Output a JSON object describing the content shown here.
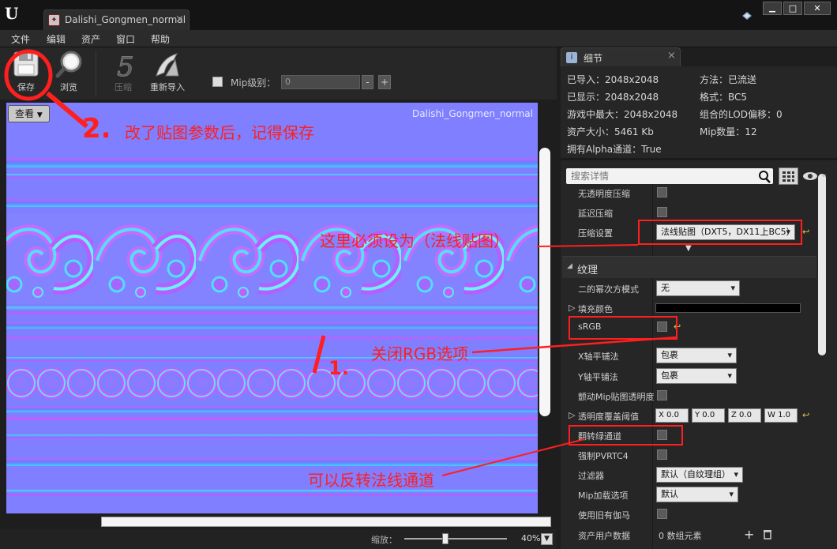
{
  "app": {
    "logo": "unreal-logo-icon",
    "tab_title": "Dalishi_Gongmen_normal",
    "tab_close": "×",
    "window_min": "▁",
    "window_max": "□",
    "window_close": "✕"
  },
  "menu": [
    "文件",
    "编辑",
    "资产",
    "窗口",
    "帮助"
  ],
  "toolbar": {
    "save": "保存",
    "browse": "浏览",
    "compress": "压缩",
    "reimport": "重新导入",
    "mip_label": "Mip级别：",
    "mip_value": "0",
    "mip_minus": "-",
    "mip_plus": "+"
  },
  "viewport": {
    "view_button": "查看",
    "texture_name": "Dalishi_Gongmen_normal",
    "zoom_label": "缩放：",
    "zoom_value": "40%",
    "zoom_fraction": 0.4
  },
  "details": {
    "tab_label": "细节",
    "tab_close": "×",
    "info_left": [
      "已导入：2048x2048",
      "已显示：2048x2048",
      "游戏中最大：2048x2048",
      "资产大小：5461 Kb",
      "拥有Alpha通道：True"
    ],
    "info_right": [
      "方法：已流送",
      "格式：BC5",
      "组合的LOD偏移：0",
      "Mip数量：12"
    ],
    "search_placeholder": "搜索详情",
    "rows_top": [
      {
        "label": "无透明度压缩",
        "control": "checkbox"
      },
      {
        "label": "延迟压缩",
        "control": "checkbox"
      },
      {
        "label": "压缩设置",
        "control": "dropdown",
        "value": "法线贴图（DXT5，DX11上BC5）"
      }
    ],
    "section_texture": "纹理",
    "rows": [
      {
        "label": "二的幂次方模式",
        "value": "无"
      },
      {
        "label": "填充颜色"
      },
      {
        "label": "sRGB"
      },
      {
        "label": "X轴平铺法",
        "value": "包裹"
      },
      {
        "label": "Y轴平铺法",
        "value": "包裹"
      },
      {
        "label": "颤动Mip贴图透明度"
      },
      {
        "label": "透明度覆盖阈值",
        "x": "X",
        "y": "Y",
        "z": "Z",
        "w": "W",
        "xv": "0.0",
        "yv": "0.0",
        "zv": "0.0",
        "wv": "1.0"
      },
      {
        "label": "翻转绿通道"
      },
      {
        "label": "强制PVRTC4"
      },
      {
        "label": "过滤器",
        "value": "默认（自纹理组）"
      },
      {
        "label": "Mip加载选项",
        "value": "默认"
      },
      {
        "label": "使用旧有伽马"
      },
      {
        "label": "资产用户数据",
        "value": "0 数组元素"
      }
    ]
  },
  "annotations": {
    "step2": "2.",
    "step2_text": "改了贴图参数后，记得保存",
    "compression_note": "这里必须设为（法线贴图）",
    "step1": "1.",
    "srgb_note": "关闭RGB选项",
    "flip_note": "可以反转法线通道"
  },
  "colors": {
    "annotation": "#ff1f1f",
    "normal_base": "#7f7fff",
    "panel_bg": "#262626"
  }
}
